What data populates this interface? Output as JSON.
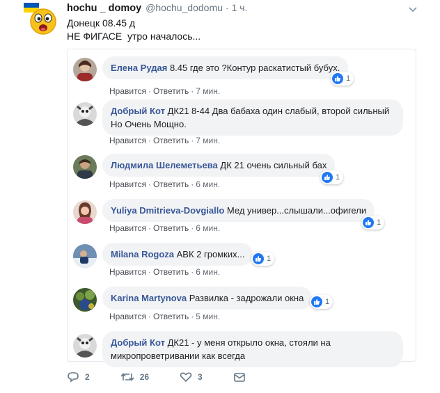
{
  "tweet": {
    "author_name": "hochu _ domoy",
    "author_handle": "@hochu_dodomu",
    "dot": "·",
    "time": "1 ч.",
    "text_line1": "Донецк 08.45 д",
    "text_line2": "НЕ ФИГАСЕ  утро началось..."
  },
  "actions_label_like": "Нравится",
  "actions_label_reply": "Ответить",
  "actions_sep": "·",
  "comments": [
    {
      "name": "Елена Рудая",
      "text": "8.45 где это ?Контур раскатистый бубух.",
      "time": "7 мин.",
      "likes": "1"
    },
    {
      "name": "Добрый Кот",
      "text": "ДК21 8-44 Два бабаха один слабый, второй сильный Но Очень Мощно.",
      "time": "7 мин.",
      "likes": ""
    },
    {
      "name": "Людмила Шелеметьева",
      "text": "ДК 21 очень сильный бах",
      "time": "6 мин.",
      "likes": "1"
    },
    {
      "name": "Yuliya Dmitrieva-Dovgiallo",
      "text": "Мед универ...слышали...офигели",
      "time": "6 мин.",
      "likes": "1"
    },
    {
      "name": "Milana Rogoza",
      "text": "АВК 2 громких...",
      "time": "6 мин.",
      "likes": "1"
    },
    {
      "name": "Karina Martynova",
      "text": "Развилка - задрожали окна",
      "time": "5 мин.",
      "likes": "1"
    },
    {
      "name": "Добрый Кот",
      "text": "ДК21 - у меня открыло окна, стояли на микропроветривании как всегда",
      "time": "",
      "likes": ""
    }
  ],
  "footer": {
    "replies": "2",
    "retweets": "26",
    "likes": "3"
  },
  "colors": {
    "fb_name": "#385898",
    "bubble_bg": "#f2f3f5",
    "like_blue": "#2078f4",
    "twitter_gray": "#657786"
  },
  "icons": [
    "emoji-face-icon",
    "chevron-down-icon",
    "like-thumb-icon",
    "reply-icon",
    "retweet-icon",
    "heart-icon",
    "direct-message-icon"
  ]
}
